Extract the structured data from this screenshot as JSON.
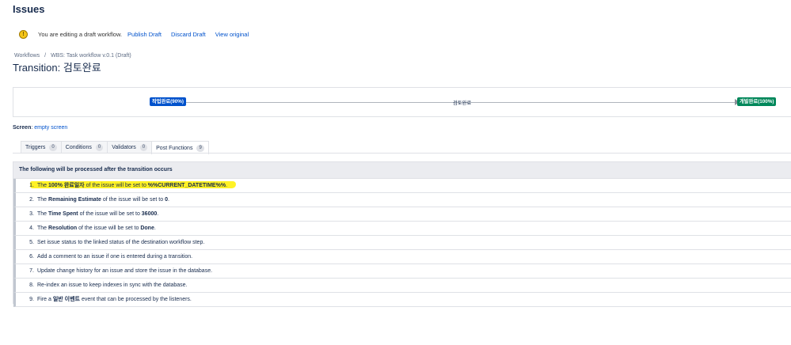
{
  "page": {
    "title": "Issues"
  },
  "draft_bar": {
    "icon": "warning-icon",
    "message": "You are editing a draft workflow.",
    "publish": "Publish Draft",
    "discard": "Discard Draft",
    "view_original": "View original"
  },
  "breadcrumb": {
    "root": "Workflows",
    "separator": "/",
    "current": "WBS: Task workflow v.0.1 (Draft)"
  },
  "transition": {
    "prefix": "Transition:",
    "name": "검토완료"
  },
  "diagram": {
    "from_status": "작업완료(90%)",
    "transition_label": "검토완료",
    "to_status": "개발완료(100%)"
  },
  "screen": {
    "label": "Screen",
    "value": "empty screen"
  },
  "tabs": [
    {
      "label": "Triggers",
      "count": "0"
    },
    {
      "label": "Conditions",
      "count": "0"
    },
    {
      "label": "Validators",
      "count": "0"
    },
    {
      "label": "Post Functions",
      "count": "9"
    }
  ],
  "post_functions": {
    "header": "The following will be processed after the transition occurs",
    "items": [
      {
        "num": "1.",
        "a": "The ",
        "b": "100% 완료일자",
        "c": " of the issue will be set to ",
        "d": "%%CURRENT_DATETIME%%",
        "e": "."
      },
      {
        "num": "2.",
        "a": "The ",
        "b": "Remaining Estimate",
        "c": " of the issue will be set to ",
        "d": "0",
        "e": "."
      },
      {
        "num": "3.",
        "a": "The ",
        "b": "Time Spent",
        "c": " of the issue will be set to ",
        "d": "36000",
        "e": "."
      },
      {
        "num": "4.",
        "a": "The ",
        "b": "Resolution",
        "c": " of the issue will be set to ",
        "d": "Done",
        "e": "."
      },
      {
        "num": "5.",
        "a": "Set issue status to the linked status of the destination workflow step.",
        "b": "",
        "c": "",
        "d": "",
        "e": ""
      },
      {
        "num": "6.",
        "a": "Add a comment to an issue if one is entered during a transition.",
        "b": "",
        "c": "",
        "d": "",
        "e": ""
      },
      {
        "num": "7.",
        "a": "Update change history for an issue and store the issue in the database.",
        "b": "",
        "c": "",
        "d": "",
        "e": ""
      },
      {
        "num": "8.",
        "a": "Re-index an issue to keep indexes in sync with the database.",
        "b": "",
        "c": "",
        "d": "",
        "e": ""
      },
      {
        "num": "9.",
        "a": "Fire a ",
        "b": "일반 이벤트",
        "c": " event that can be processed by the listeners.",
        "d": "",
        "e": ""
      }
    ]
  },
  "colors": {
    "link": "#0052cc",
    "from_status_bg": "#0052cc",
    "to_status_bg": "#00875a",
    "highlight": "#fff000"
  }
}
